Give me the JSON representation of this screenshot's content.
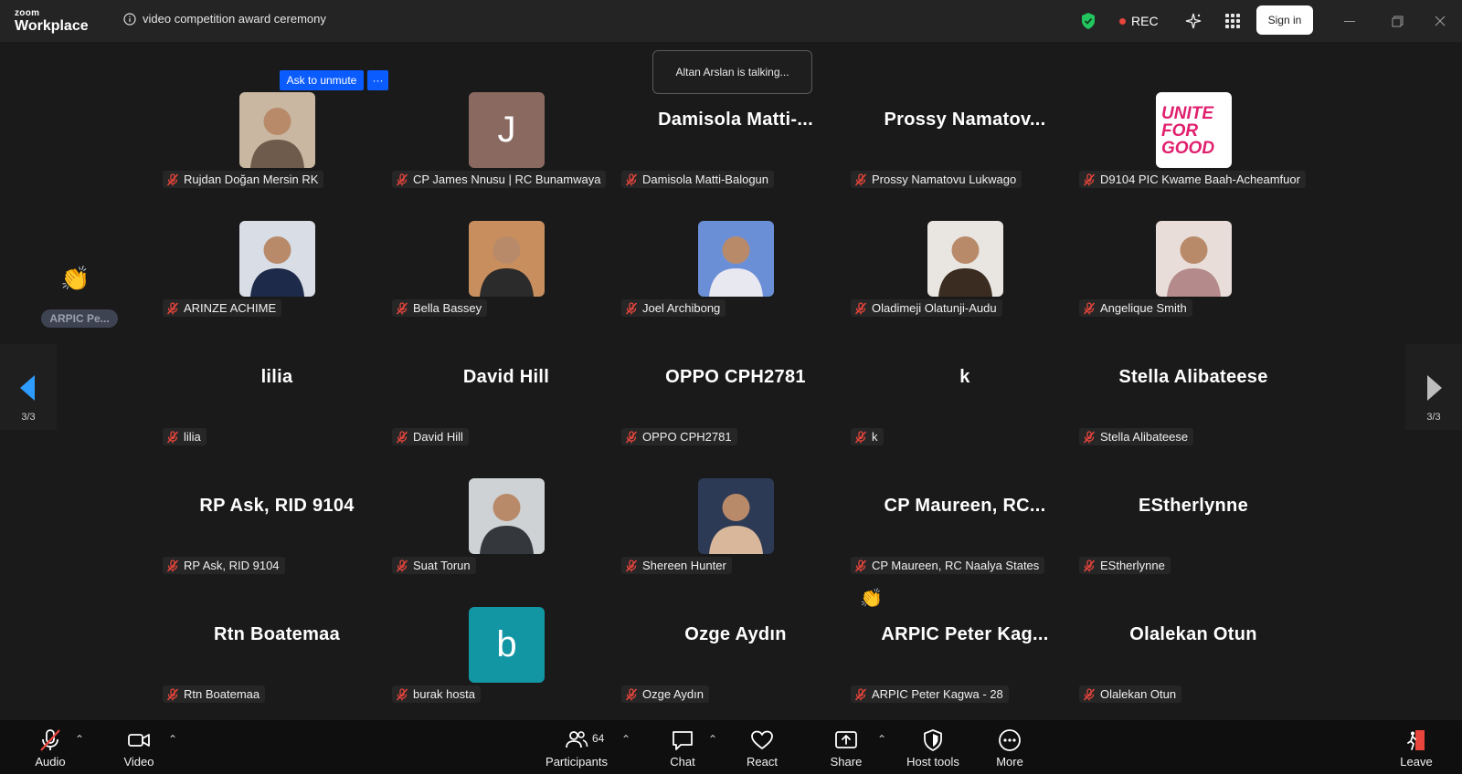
{
  "app": {
    "logo_top": "zoom",
    "logo_bottom": "Workplace"
  },
  "meeting": {
    "title": "video competition award ceremony"
  },
  "header": {
    "rec_label": "REC",
    "signin_label": "Sign in"
  },
  "overlay": {
    "talking": "Altan Arslan is talking...",
    "ask_unmute": "Ask to unmute",
    "more": "···"
  },
  "side": {
    "pill": "ARPIC Pe...",
    "page_left": "3/3",
    "page_right": "3/3"
  },
  "colors": {
    "accent": "#0b5cff",
    "mic_off": "#e8453c",
    "rec": "#e8453c",
    "shield": "#22c55e"
  },
  "participants": [
    {
      "label": "Rujdan Doğan  Mersin RK",
      "photo": true
    },
    {
      "label": "CP James Nnusu | RC Bunamwaya",
      "letter": "J",
      "bg": "#8a6a60"
    },
    {
      "label": "Damisola Matti-Balogun",
      "display": "Damisola  Matti-..."
    },
    {
      "label": "Prossy Namatovu Lukwago",
      "display": "Prossy  Namatov..."
    },
    {
      "label": "D9104 PIC Kwame Baah-Acheamfuor",
      "logo_text": "UNITE FOR GOOD"
    },
    {
      "label": "ARINZE ACHIME",
      "photo": true
    },
    {
      "label": "Bella Bassey",
      "photo": true
    },
    {
      "label": "Joel Archibong",
      "photo": true
    },
    {
      "label": "Oladimeji Olatunji-Audu",
      "photo": true
    },
    {
      "label": "Angelique Smith",
      "photo": true
    },
    {
      "label": "lilia",
      "display": "lilia"
    },
    {
      "label": "David Hill",
      "display": "David Hill"
    },
    {
      "label": "OPPO CPH2781",
      "display": "OPPO CPH2781"
    },
    {
      "label": "k",
      "display": "k"
    },
    {
      "label": "Stella Alibateese",
      "display": "Stella Alibateese"
    },
    {
      "label": "RP Ask, RID 9104",
      "display": "RP Ask, RID 9104"
    },
    {
      "label": "Suat Torun",
      "photo": true
    },
    {
      "label": "Shereen Hunter",
      "photo": true
    },
    {
      "label": "CP Maureen, RC Naalya States",
      "display": "CP  Maureen,  RC..."
    },
    {
      "label": "EStherlynne",
      "display": "EStherlynne"
    },
    {
      "label": "Rtn Boatemaa",
      "display": "Rtn Boatemaa"
    },
    {
      "label": "burak hosta",
      "letter": "b",
      "bg": "#1396a4"
    },
    {
      "label": "Ozge Aydın",
      "display": "Ozge Aydın"
    },
    {
      "label": "ARPIC Peter Kagwa - 28",
      "display": "ARPIC  Peter  Kag..."
    },
    {
      "label": "Olalekan Otun",
      "display": "Olalekan Otun"
    }
  ],
  "toolbar": {
    "audio": "Audio",
    "video": "Video",
    "participants": "Participants",
    "participants_count": "64",
    "chat": "Chat",
    "react": "React",
    "share": "Share",
    "host_tools": "Host tools",
    "more": "More",
    "leave": "Leave"
  }
}
